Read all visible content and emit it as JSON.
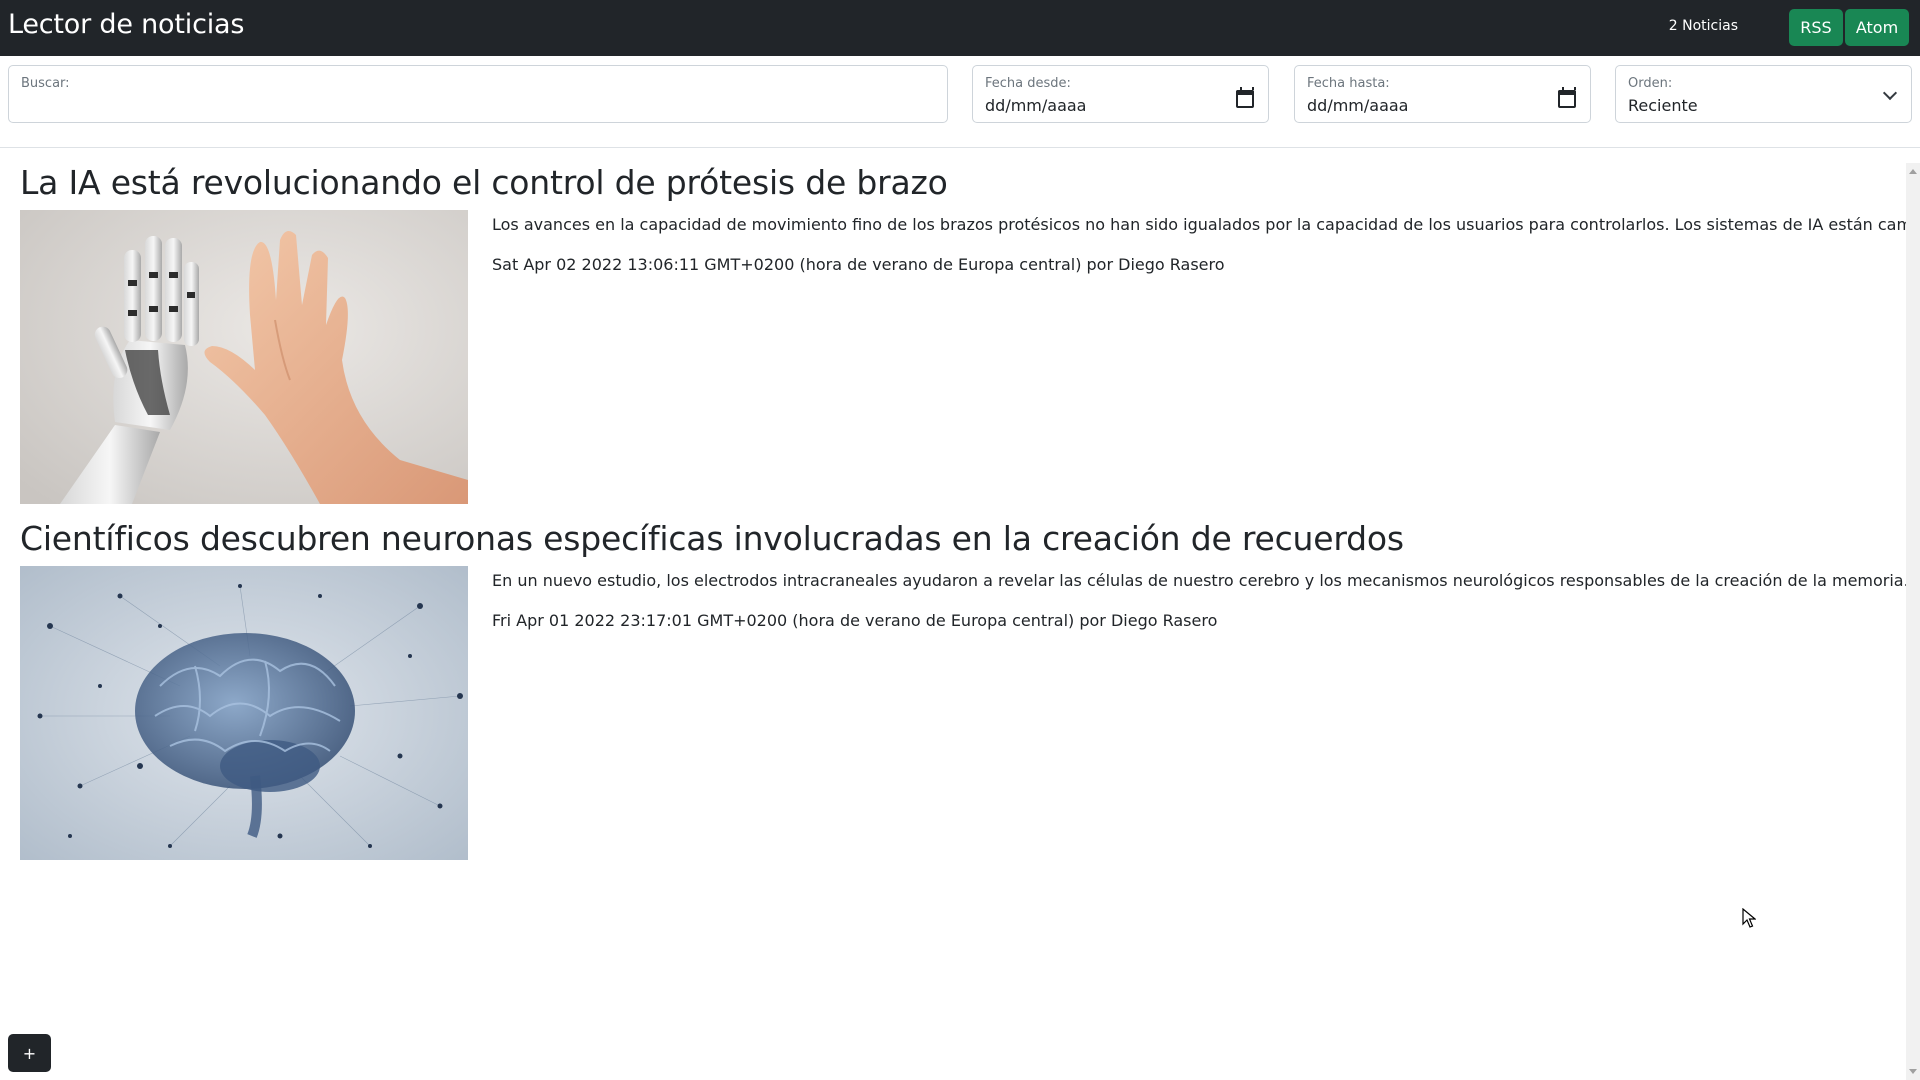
{
  "navbar": {
    "brand": "Lector de noticias",
    "count": "2 Noticias",
    "rss_label": "RSS",
    "atom_label": "Atom"
  },
  "filters": {
    "search": {
      "label": "Buscar:",
      "value": ""
    },
    "date_from": {
      "label": "Fecha desde:",
      "value": "dd/mm/aaaa"
    },
    "date_to": {
      "label": "Fecha hasta:",
      "value": "dd/mm/aaaa"
    },
    "order": {
      "label": "Orden:",
      "value": "Reciente"
    }
  },
  "articles": [
    {
      "title": "La IA está revolucionando el control de prótesis de brazo",
      "description": "Los avances en la capacidad de movimiento fino de los brazos protésicos no han sido igualados por la capacidad de los usuarios para controlarlos. Los sistemas de IA están cambiando",
      "meta": "Sat Apr 02 2022 13:06:11 GMT+0200 (hora de verano de Europa central) por Diego Rasero",
      "image": "robot-hand-high-five-image"
    },
    {
      "title": "Científicos descubren neuronas específicas involucradas en la creación de recuerdos",
      "description": "En un nuevo estudio, los electrodos intracraneales ayudaron a revelar las células de nuestro cerebro y los mecanismos neurológicos responsables de la creación de la memoria.",
      "meta": "Fri Apr 01 2022 23:17:01 GMT+0200 (hora de verano de Europa central) por Diego Rasero",
      "image": "neural-brain-image"
    }
  ],
  "add_button_label": "+",
  "colors": {
    "navbar": "#212529",
    "success": "#198754"
  }
}
